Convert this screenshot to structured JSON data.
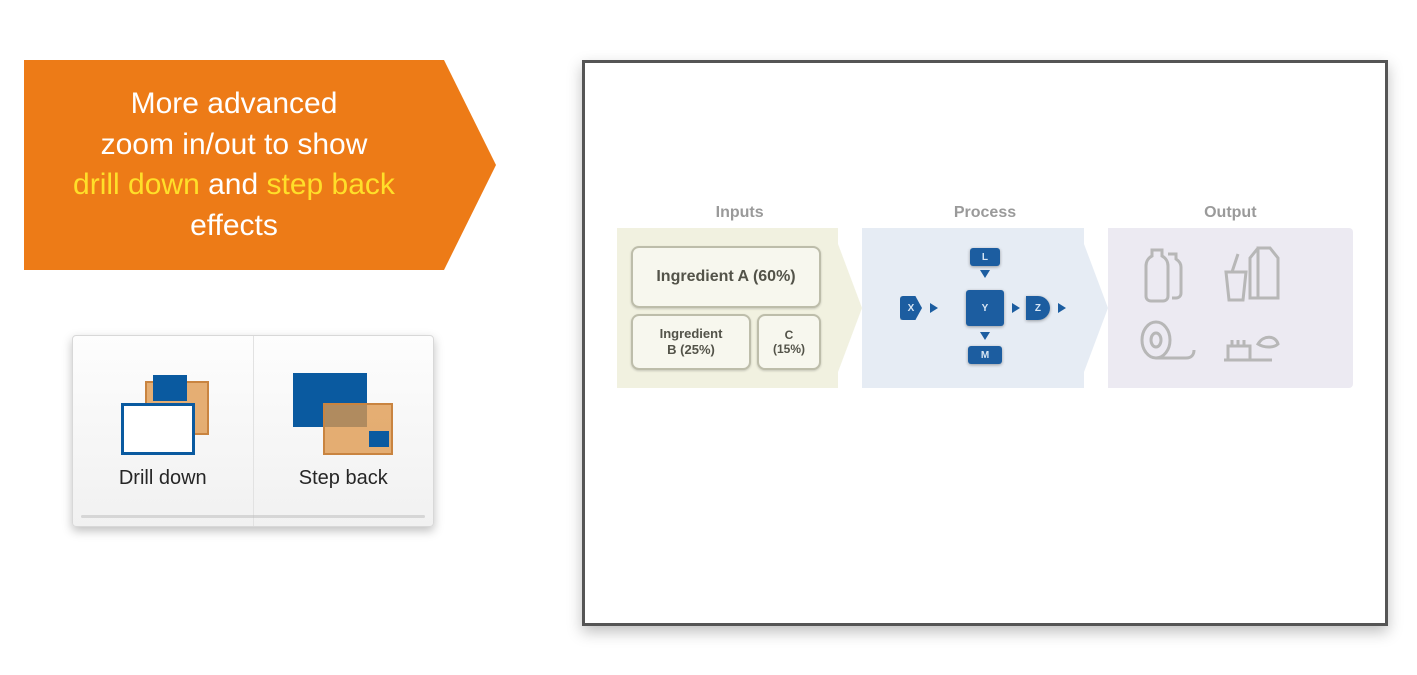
{
  "callout": {
    "l1": "More advanced",
    "l2": "zoom in/out to show",
    "hl1": "drill down",
    "and": " and ",
    "hl2": "step back",
    "l4": "effects"
  },
  "toolbar": {
    "drill_label": "Drill down",
    "step_label": "Step back"
  },
  "slide": {
    "headers": {
      "inputs": "Inputs",
      "process": "Process",
      "output": "Output"
    },
    "ingredients": {
      "a": "Ingredient A (60%)",
      "b": "Ingredient\nB (25%)",
      "c": "C\n(15%)"
    },
    "process_nodes": {
      "top": "L",
      "left": "X",
      "center": "Y",
      "right": "Z",
      "bottom": "M"
    }
  }
}
